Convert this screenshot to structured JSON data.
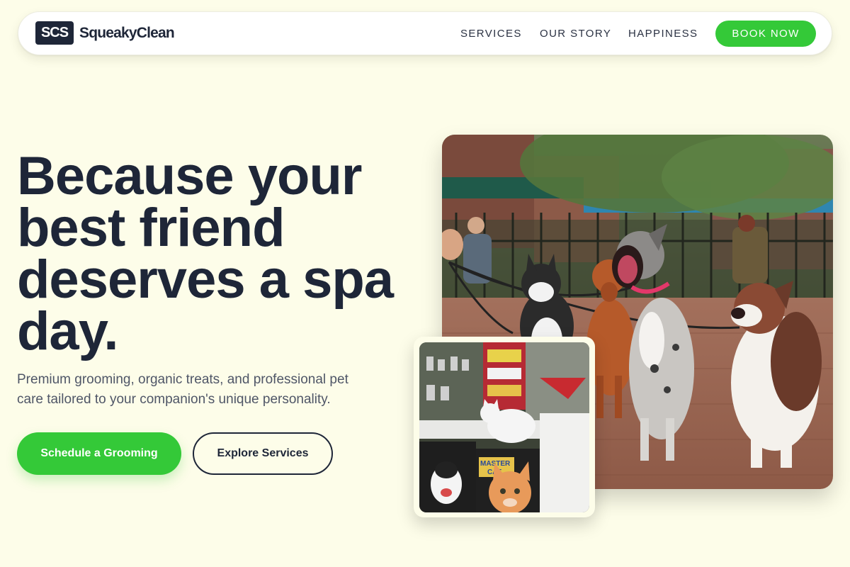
{
  "brand": {
    "mark": "SCS",
    "name": "SqueakyClean"
  },
  "nav": {
    "links": [
      "SERVICES",
      "OUR STORY",
      "HAPPINESS"
    ],
    "cta": "BOOK NOW"
  },
  "hero": {
    "headline_lines": [
      "Because your",
      "best friend",
      "deserves a spa",
      "day."
    ],
    "subhead": "Premium grooming, organic treats, and professional pet care tailored to your companion's unique personality.",
    "primary_cta": "Schedule a Grooming",
    "secondary_cta": "Explore Services"
  },
  "images": {
    "main": "photo-dogs-on-leashes-in-park",
    "inset": "photo-cats-in-shop"
  },
  "colors": {
    "background": "#fdfde9",
    "ink": "#1e2638",
    "accent": "#34c938",
    "muted": "#4f5667"
  }
}
